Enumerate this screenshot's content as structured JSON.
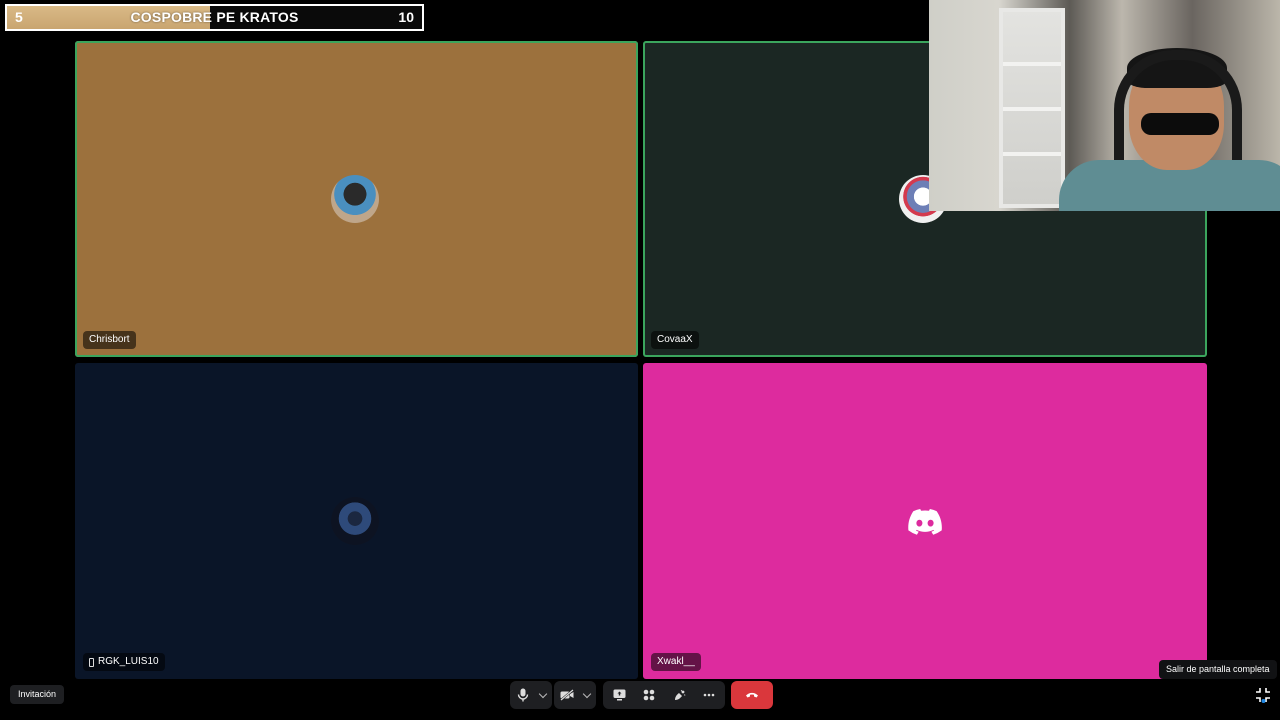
{
  "scorebar": {
    "left_score": "5",
    "title": "COSPOBRE PE KRATOS",
    "right_score": "10",
    "fill_fraction": 0.49,
    "fill_color": "#d4b27d"
  },
  "tiles": [
    {
      "name": "Chrisbort",
      "bg": "#9c713d",
      "speaking": true,
      "mobile": false
    },
    {
      "name": "CovaaX",
      "bg": "#1b2723",
      "speaking": true,
      "mobile": false
    },
    {
      "name": "RGK_LUIS10",
      "bg": "#0a1528",
      "speaking": false,
      "mobile": true
    },
    {
      "name": "Xwakl__",
      "bg": "#dd2b9e",
      "speaking": false,
      "mobile": false
    }
  ],
  "bottom": {
    "invite_label": "Invitación",
    "tooltip": "Salir de pantalla completa"
  },
  "icons": {
    "mic": "microphone-icon",
    "camera_off": "camera-off-icon",
    "screen_share": "screen-share-icon",
    "activities": "activities-icon",
    "soundboard": "soundboard-icon",
    "more": "more-icon",
    "hangup": "hang-up-icon",
    "exit_fullscreen": "exit-fullscreen-icon"
  },
  "colors": {
    "speaking_ring": "#3ba55d",
    "hangup": "#da373c",
    "discord_pink": "#dd2b9e"
  }
}
